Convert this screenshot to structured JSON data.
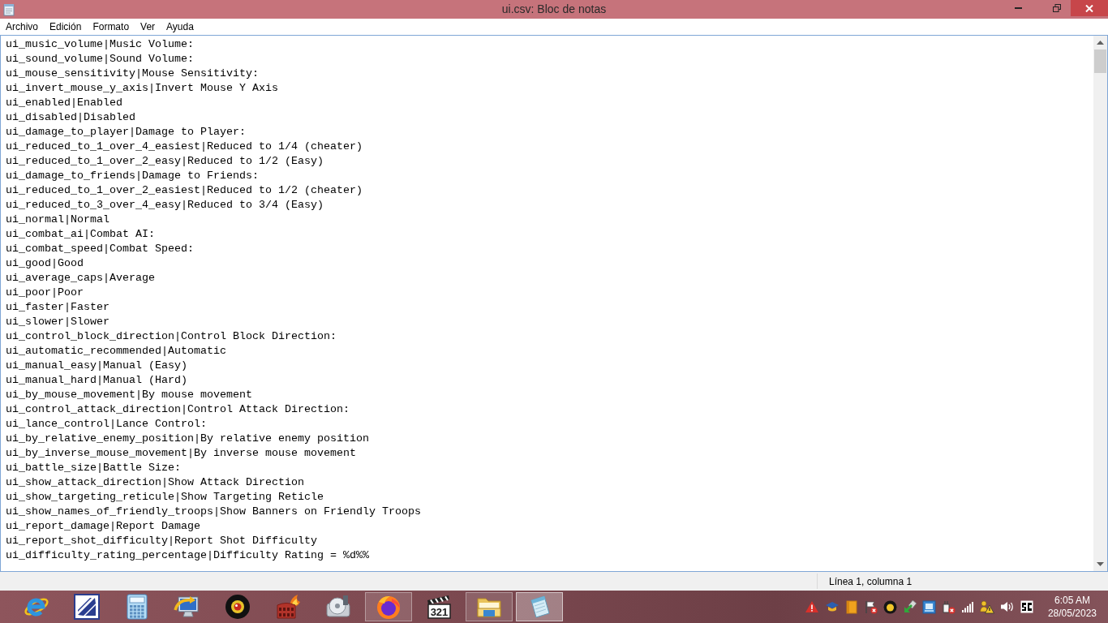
{
  "window": {
    "title": "ui.csv: Bloc de notas"
  },
  "menu": [
    "Archivo",
    "Edición",
    "Formato",
    "Ver",
    "Ayuda"
  ],
  "editor": {
    "lines": [
      "ui_music_volume|Music Volume:",
      "ui_sound_volume|Sound Volume:",
      "ui_mouse_sensitivity|Mouse Sensitivity:",
      "ui_invert_mouse_y_axis|Invert Mouse Y Axis",
      "ui_enabled|Enabled",
      "ui_disabled|Disabled",
      "ui_damage_to_player|Damage to Player:",
      "ui_reduced_to_1_over_4_easiest|Reduced to 1/4 (cheater)",
      "ui_reduced_to_1_over_2_easy|Reduced to 1/2 (Easy)",
      "ui_damage_to_friends|Damage to Friends:",
      "ui_reduced_to_1_over_2_easiest|Reduced to 1/2 (cheater)",
      "ui_reduced_to_3_over_4_easy|Reduced to 3/4 (Easy)",
      "ui_normal|Normal",
      "ui_combat_ai|Combat AI:",
      "ui_combat_speed|Combat Speed:",
      "ui_good|Good",
      "ui_average_caps|Average",
      "ui_poor|Poor",
      "ui_faster|Faster",
      "ui_slower|Slower",
      "ui_control_block_direction|Control Block Direction:",
      "ui_automatic_recommended|Automatic",
      "ui_manual_easy|Manual (Easy)",
      "ui_manual_hard|Manual (Hard)",
      "ui_by_mouse_movement|By mouse movement",
      "ui_control_attack_direction|Control Attack Direction:",
      "ui_lance_control|Lance Control:",
      "ui_by_relative_enemy_position|By relative enemy position",
      "ui_by_inverse_mouse_movement|By inverse mouse movement",
      "ui_battle_size|Battle Size:",
      "ui_show_attack_direction|Show Attack Direction",
      "ui_show_targeting_reticule|Show Targeting Reticle",
      "ui_show_names_of_friendly_troops|Show Banners on Friendly Troops",
      "ui_report_damage|Report Damage",
      "ui_report_shot_difficulty|Report Shot Difficulty",
      "ui_difficulty_rating_percentage|Difficulty Rating = %d%%"
    ]
  },
  "status_bar": {
    "position": "Línea 1, columna 1"
  },
  "taskbar": {
    "apps": [
      {
        "kind": "ie",
        "running": false,
        "selected": false
      },
      {
        "kind": "editor",
        "running": false,
        "selected": false
      },
      {
        "kind": "calculator",
        "running": false,
        "selected": false
      },
      {
        "kind": "monitor",
        "running": false,
        "selected": false
      },
      {
        "kind": "webcam",
        "running": false,
        "selected": false
      },
      {
        "kind": "burner",
        "running": false,
        "selected": false
      },
      {
        "kind": "media",
        "running": false,
        "selected": false
      },
      {
        "kind": "firefox",
        "running": true,
        "selected": false
      },
      {
        "kind": "player",
        "running": false,
        "selected": false,
        "badge": "321"
      },
      {
        "kind": "folder",
        "running": true,
        "selected": false
      },
      {
        "kind": "notepad",
        "running": true,
        "selected": true
      }
    ],
    "clock": {
      "time": "6:05 AM",
      "date": "28/05/2023"
    }
  }
}
